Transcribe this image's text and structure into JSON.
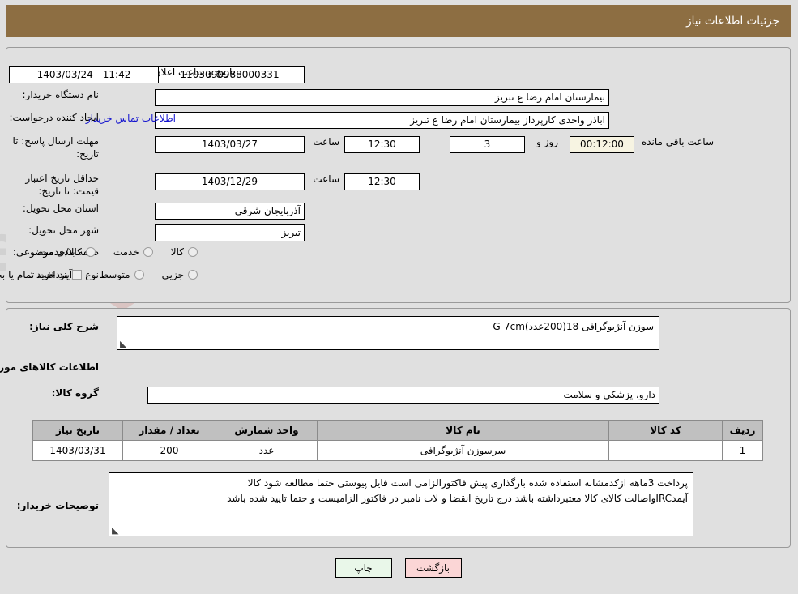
{
  "header": {
    "title": "جزئیات اطلاعات نیاز"
  },
  "watermark": {
    "text": "AriaTender.net"
  },
  "form": {
    "need_number": {
      "label": "شماره نیاز:",
      "value": "1103090988000331"
    },
    "announce_datetime": {
      "label": "تاریخ و ساعت اعلان عمومی:",
      "value": "11:42 - 1403/03/24"
    },
    "buyer_org": {
      "label": "نام دستگاه خریدار:",
      "value": "بیمارستان امام رضا  ع  تبریز"
    },
    "request_creator": {
      "label": "ایجاد کننده درخواست:",
      "value": "اباذر واحدی کارپرداز بیمارستان امام رضا  ع  تبریز"
    },
    "buyer_contact_link": "اطلاعات تماس خریدار",
    "response_deadline": {
      "label": "مهلت ارسال پاسخ: تا تاریخ:",
      "date": "1403/03/27",
      "time_label": "ساعت",
      "time": "12:30",
      "days": "3",
      "days_label": "روز و",
      "countdown": "00:12:00",
      "remaining_label": "ساعت باقی مانده"
    },
    "price_validity": {
      "label": "حداقل تاریخ اعتبار قیمت: تا تاریخ:",
      "date": "1403/12/29",
      "time_label": "ساعت",
      "time": "12:30"
    },
    "delivery_province": {
      "label": "استان محل تحویل:",
      "value": "آذربایجان شرقی"
    },
    "delivery_city": {
      "label": "شهر محل تحویل:",
      "value": "تبریز"
    },
    "category": {
      "label": "طبقه بندی موضوعی:",
      "options": [
        "کالا",
        "خدمت",
        "کالا/خدمت"
      ],
      "selected": null
    },
    "purchase_type": {
      "label": "نوع فرآیند خرید :",
      "options": [
        "جزیی",
        "متوسط"
      ],
      "selected": null,
      "note": "پرداخت تمام یا بخشی از مبلغ خرید،از محل \"اسناد خزانه اسلامی\" خواهد بود."
    }
  },
  "detail": {
    "summary": {
      "label": "شرح کلی نیاز:",
      "value": "سوزن آنژیوگرافی 18(200عدد)G-7cm"
    },
    "goods_section_title": "اطلاعات کالاهای مورد نیاز",
    "goods_group": {
      "label": "گروه کالا:",
      "value": "دارو، پزشکی و سلامت"
    },
    "table": {
      "headers": [
        "ردیف",
        "کد کالا",
        "نام کالا",
        "واحد شمارش",
        "تعداد / مقدار",
        "تاریخ نیاز"
      ],
      "rows": [
        {
          "row": "1",
          "code": "--",
          "name": "سرسوزن آنژیوگرافی",
          "unit": "عدد",
          "qty": "200",
          "need_date": "1403/03/31"
        }
      ]
    },
    "buyer_notes": {
      "label": "توضیحات خریدار:",
      "line1": "پرداخت 3ماهه ازکدمشابه استفاده شده بارگذاری پیش فاکتورالزامی است فایل پیوستی حتما مطالعه شود کالا",
      "line2": "آیمدIRCواصالت کالای کالا معتبرداشته باشد درج تاریخ انقضا و لات نامبر در فاکتور الزامیست و حتما  تایید شده باشد"
    }
  },
  "buttons": {
    "print": "چاپ",
    "back": "بازگشت"
  },
  "colors": {
    "header_bg": "#8d6e42",
    "page_bg": "#e0e0e0",
    "link": "#1414cf",
    "table_header_bg": "#c0c0c0",
    "print_btn_bg": "#e9f7e9",
    "back_btn_bg": "#fbd6d6",
    "countdown_bg": "#f7f4e2"
  }
}
